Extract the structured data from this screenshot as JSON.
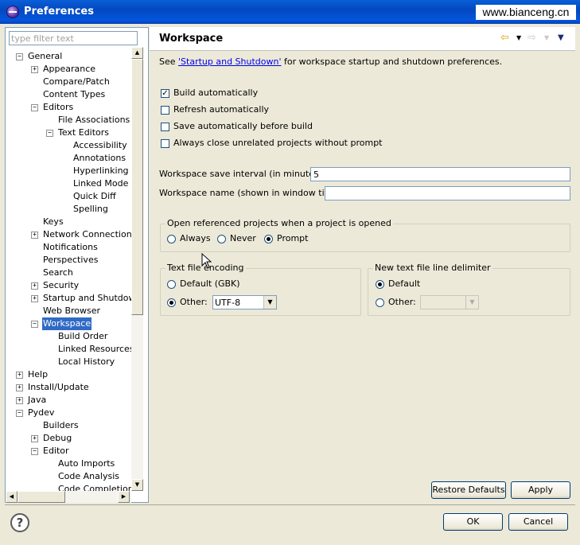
{
  "window": {
    "title": "Preferences",
    "watermark": "www.bianceng.cn"
  },
  "filter": {
    "placeholder": "type filter text",
    "value": ""
  },
  "tree": [
    {
      "label": "General",
      "level": 0,
      "expander": "-"
    },
    {
      "label": "Appearance",
      "level": 1,
      "expander": "+"
    },
    {
      "label": "Compare/Patch",
      "level": 1,
      "expander": ""
    },
    {
      "label": "Content Types",
      "level": 1,
      "expander": ""
    },
    {
      "label": "Editors",
      "level": 1,
      "expander": "-"
    },
    {
      "label": "File Associations",
      "level": 2,
      "expander": ""
    },
    {
      "label": "Text Editors",
      "level": 2,
      "expander": "-"
    },
    {
      "label": "Accessibility",
      "level": 3,
      "expander": ""
    },
    {
      "label": "Annotations",
      "level": 3,
      "expander": ""
    },
    {
      "label": "Hyperlinking",
      "level": 3,
      "expander": ""
    },
    {
      "label": "Linked Mode",
      "level": 3,
      "expander": ""
    },
    {
      "label": "Quick Diff",
      "level": 3,
      "expander": ""
    },
    {
      "label": "Spelling",
      "level": 3,
      "expander": ""
    },
    {
      "label": "Keys",
      "level": 1,
      "expander": ""
    },
    {
      "label": "Network Connections",
      "level": 1,
      "expander": "+"
    },
    {
      "label": "Notifications",
      "level": 1,
      "expander": ""
    },
    {
      "label": "Perspectives",
      "level": 1,
      "expander": ""
    },
    {
      "label": "Search",
      "level": 1,
      "expander": ""
    },
    {
      "label": "Security",
      "level": 1,
      "expander": "+"
    },
    {
      "label": "Startup and Shutdown",
      "level": 1,
      "expander": "+"
    },
    {
      "label": "Web Browser",
      "level": 1,
      "expander": ""
    },
    {
      "label": "Workspace",
      "level": 1,
      "expander": "-",
      "selected": true
    },
    {
      "label": "Build Order",
      "level": 2,
      "expander": ""
    },
    {
      "label": "Linked Resources",
      "level": 2,
      "expander": ""
    },
    {
      "label": "Local History",
      "level": 2,
      "expander": ""
    },
    {
      "label": "Help",
      "level": 0,
      "expander": "+"
    },
    {
      "label": "Install/Update",
      "level": 0,
      "expander": "+"
    },
    {
      "label": "Java",
      "level": 0,
      "expander": "+"
    },
    {
      "label": "Pydev",
      "level": 0,
      "expander": "-"
    },
    {
      "label": "Builders",
      "level": 1,
      "expander": ""
    },
    {
      "label": "Debug",
      "level": 1,
      "expander": "+"
    },
    {
      "label": "Editor",
      "level": 1,
      "expander": "-"
    },
    {
      "label": "Auto Imports",
      "level": 2,
      "expander": ""
    },
    {
      "label": "Code Analysis",
      "level": 2,
      "expander": ""
    },
    {
      "label": "Code Completion",
      "level": 2,
      "expander": ""
    }
  ],
  "page": {
    "title": "Workspace",
    "desc_prefix": "See ",
    "desc_link": "'Startup and Shutdown'",
    "desc_suffix": " for workspace startup and shutdown preferences.",
    "checkboxes": [
      {
        "label": "Build automatically",
        "checked": true
      },
      {
        "label": "Refresh automatically",
        "checked": false
      },
      {
        "label": "Save automatically before build",
        "checked": false
      },
      {
        "label": "Always close unrelated projects without prompt",
        "checked": false
      }
    ],
    "save_interval_label": "Workspace save interval (in minutes):",
    "save_interval_value": "5",
    "ws_name_label": "Workspace name (shown in window title):",
    "ws_name_value": "",
    "open_ref": {
      "label": "Open referenced projects when a project is opened",
      "options": [
        "Always",
        "Never",
        "Prompt"
      ],
      "selected": "Prompt"
    },
    "encoding": {
      "label": "Text file encoding",
      "default_label": "Default (GBK)",
      "other_label": "Other:",
      "other_value": "UTF-8",
      "selected": "other"
    },
    "delimiter": {
      "label": "New text file line delimiter",
      "default_label": "Default",
      "other_label": "Other:",
      "other_value": "",
      "selected": "default"
    },
    "restore_label": "Restore Defaults",
    "apply_label": "Apply"
  },
  "footer": {
    "ok_label": "OK",
    "cancel_label": "Cancel"
  },
  "icons": {
    "back": "back-arrow-icon",
    "forward": "forward-arrow-icon",
    "menu": "view-menu-icon",
    "help": "help-icon"
  },
  "colors": {
    "selection": "#316ac5",
    "link": "#0000ee",
    "titlebar": "#0348c0"
  }
}
